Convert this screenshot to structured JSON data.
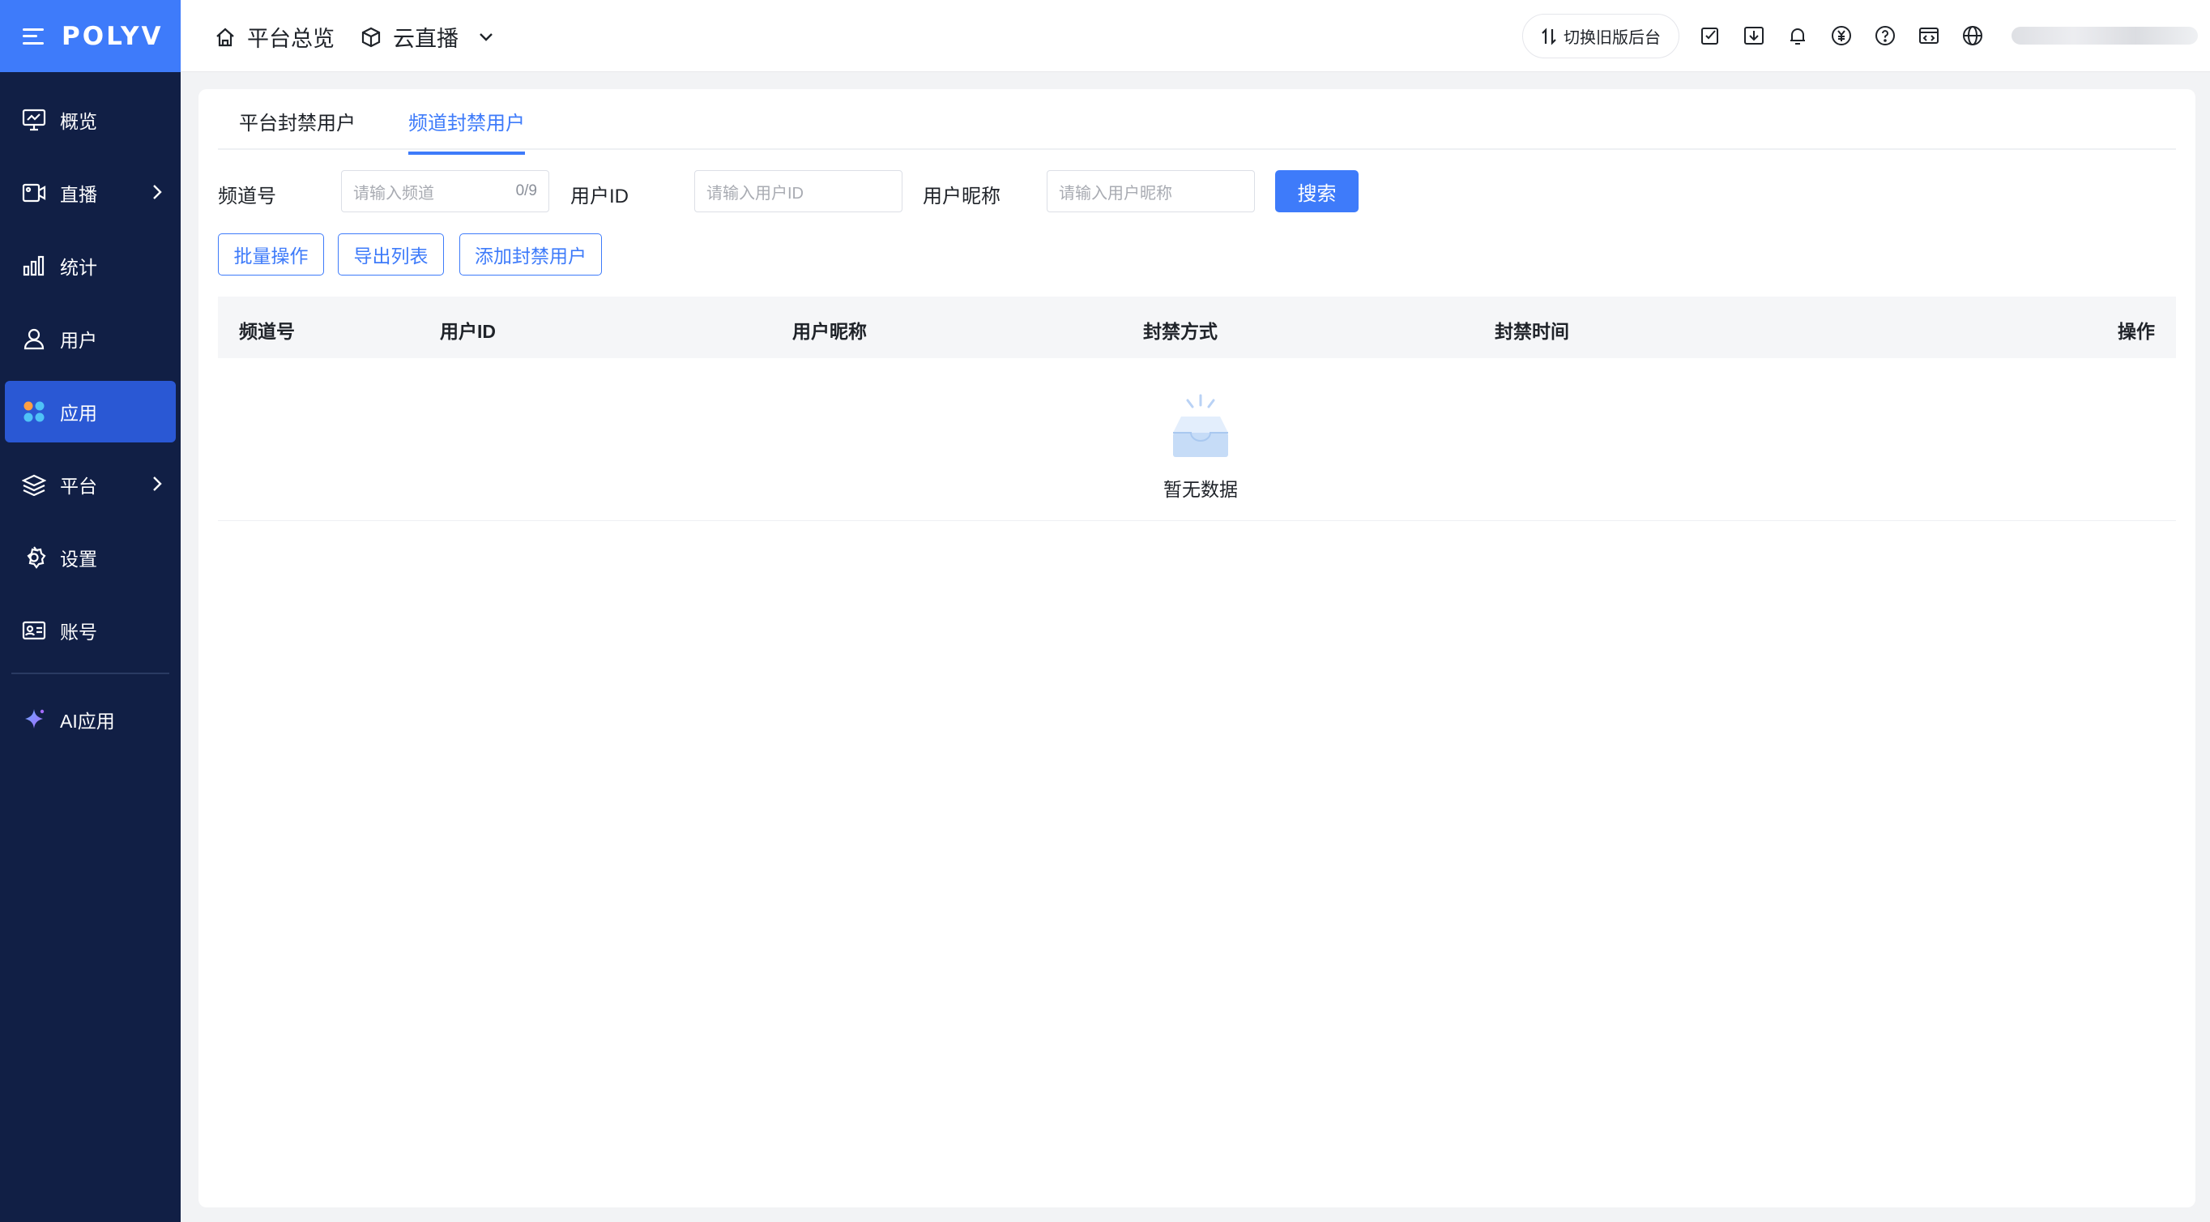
{
  "sidebar": {
    "logo": "POLYV",
    "items": [
      {
        "label": "概览",
        "icon": "monitor-chart-icon"
      },
      {
        "label": "直播",
        "icon": "video-camera-icon",
        "expandable": true
      },
      {
        "label": "统计",
        "icon": "bar-chart-icon"
      },
      {
        "label": "用户",
        "icon": "user-icon"
      },
      {
        "label": "应用",
        "icon": "apps-grid-icon",
        "active": true
      },
      {
        "label": "平台",
        "icon": "layers-icon",
        "expandable": true
      },
      {
        "label": "设置",
        "icon": "gear-icon"
      },
      {
        "label": "账号",
        "icon": "id-card-icon"
      }
    ],
    "ai_item": {
      "label": "AI应用",
      "icon": "sparkle-icon"
    }
  },
  "header": {
    "breadcrumb_home": "平台总览",
    "breadcrumb_product": "云直播",
    "switch_label": "切换旧版后台",
    "icons": [
      "checklist-icon",
      "download-icon",
      "bell-icon",
      "yuan-icon",
      "help-icon",
      "code-window-icon",
      "globe-icon"
    ]
  },
  "tabs": [
    {
      "label": "平台封禁用户",
      "active": false
    },
    {
      "label": "频道封禁用户",
      "active": true
    }
  ],
  "filters": {
    "channel_label": "频道号",
    "channel_placeholder": "请输入频道",
    "channel_count": "0/9",
    "userid_label": "用户ID",
    "userid_placeholder": "请输入用户ID",
    "nickname_label": "用户昵称",
    "nickname_placeholder": "请输入用户昵称",
    "search_label": "搜索"
  },
  "actions": {
    "batch": "批量操作",
    "export": "导出列表",
    "add": "添加封禁用户"
  },
  "table": {
    "columns": [
      "频道号",
      "用户ID",
      "用户昵称",
      "封禁方式",
      "封禁时间",
      "操作"
    ],
    "rows": [],
    "empty_text": "暂无数据"
  },
  "colors": {
    "accent": "#3e7bfa",
    "sidebar_bg": "#111f45",
    "sidebar_active": "#2a58d4"
  }
}
